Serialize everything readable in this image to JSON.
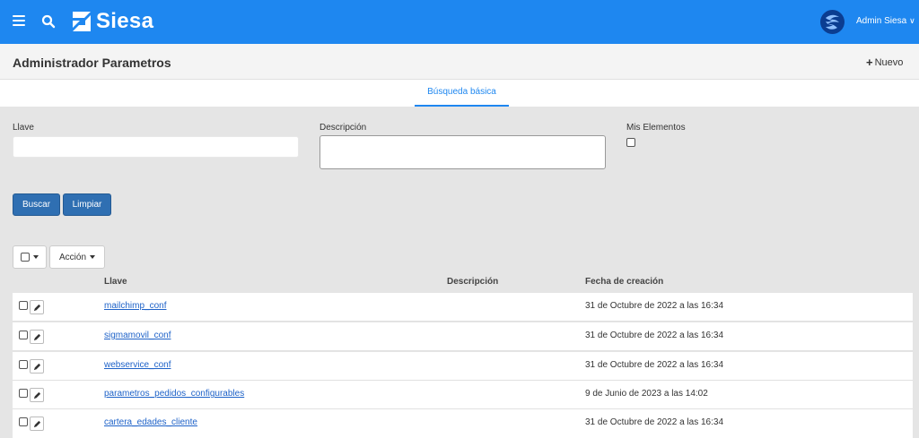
{
  "topbar": {
    "brand": "Siesa",
    "user": "Admin Siesa",
    "colors": {
      "primary": "#1e87f0",
      "avatar": "#0b3d91"
    }
  },
  "header": {
    "title": "Administrador Parametros",
    "new_label": "Nuevo"
  },
  "tabs": [
    {
      "label": "Búsqueda básica",
      "active": true
    }
  ],
  "form": {
    "llave_label": "Llave",
    "llave_value": "",
    "descripcion_label": "Descripción",
    "descripcion_value": "",
    "mis_elementos_label": "Mis Elementos",
    "mis_elementos_checked": false,
    "buscar_label": "Buscar",
    "limpiar_label": "Limpiar"
  },
  "toolbar": {
    "accion_label": "Acción"
  },
  "table": {
    "columns": [
      "Llave",
      "Descripción",
      "Fecha de creación"
    ],
    "rows": [
      {
        "llave": "mailchimp_conf",
        "descripcion": "",
        "fecha": "31 de Octubre de 2022 a las 16:34"
      },
      {
        "llave": "sigmamovil_conf",
        "descripcion": "",
        "fecha": "31 de Octubre de 2022 a las 16:34"
      },
      {
        "llave": "webservice_conf",
        "descripcion": "",
        "fecha": "31 de Octubre de 2022 a las 16:34"
      },
      {
        "llave": "parametros_pedidos_configurables",
        "descripcion": "",
        "fecha": "9 de Junio de 2023 a las 14:02"
      },
      {
        "llave": "cartera_edades_cliente",
        "descripcion": "",
        "fecha": "31 de Octubre de 2022 a las 16:34"
      }
    ]
  }
}
